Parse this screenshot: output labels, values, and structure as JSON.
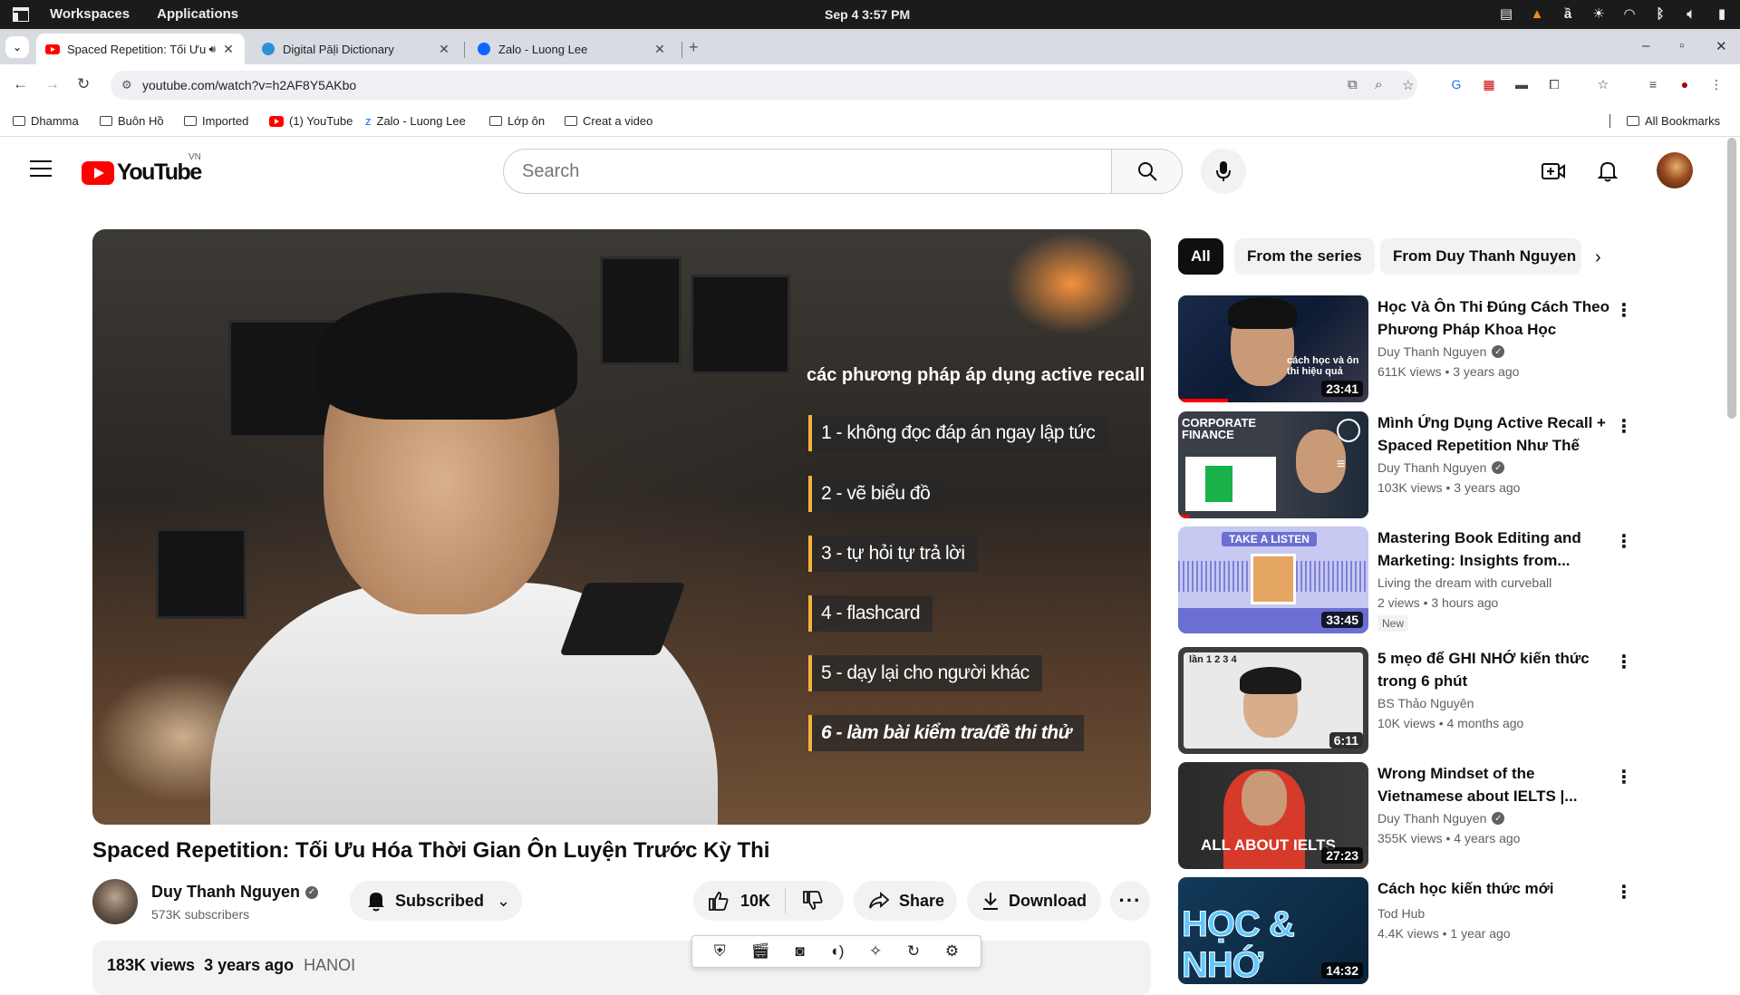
{
  "os": {
    "menu": [
      "Workspaces",
      "Applications"
    ],
    "clock": "Sep 4   3:57 PM"
  },
  "tabs": [
    {
      "title": "Spaced Repetition: Tối Ưu",
      "active": true
    },
    {
      "title": "Digital Pāḷi Dictionary",
      "active": false
    },
    {
      "title": "Zalo - Luong Lee",
      "active": false
    }
  ],
  "address": {
    "url": "youtube.com/watch?v=h2AF8Y5AKbo"
  },
  "bookmarks": [
    {
      "label": "Dhamma",
      "type": "folder"
    },
    {
      "label": "Buôn Hồ",
      "type": "folder"
    },
    {
      "label": "Imported",
      "type": "folder"
    },
    {
      "label": "(1) YouTube",
      "type": "youtube"
    },
    {
      "label": "Zalo - Luong Lee",
      "type": "zalo"
    },
    {
      "label": "Lớp ôn",
      "type": "folder"
    },
    {
      "label": "Creat a video",
      "type": "folder"
    },
    {
      "label": "All Bookmarks",
      "type": "folder"
    }
  ],
  "yt": {
    "logo_text": "YouTube",
    "country": "VN",
    "search_placeholder": "Search"
  },
  "video": {
    "overlay_title": "các phương pháp áp dụng active recall",
    "steps": [
      "1 - không đọc đáp án ngay lập tức",
      "2 - vẽ biểu đồ",
      "3 - tự hỏi tự trả lời",
      "4 - flashcard",
      "5 - dạy lại cho người khác",
      "6 - làm bài kiểm tra/đề thi thử"
    ],
    "title": "Spaced Repetition: Tối Ưu Hóa Thời Gian Ôn Luyện Trước Kỳ Thi",
    "channel": "Duy Thanh Nguyen",
    "subscribers": "573K subscribers",
    "subscribe_label": "Subscribed",
    "likes": "10K",
    "share_label": "Share",
    "download_label": "Download",
    "views": "183K views",
    "age": "3 years ago",
    "location": "HANOI"
  },
  "chips": [
    "All",
    "From the series",
    "From Duy Thanh Nguyen"
  ],
  "recommendations": [
    {
      "title": "Học Và Ôn Thi Đúng Cách Theo Phương Pháp Khoa Học",
      "channel": "Duy Thanh Nguyen",
      "verified": true,
      "views": "611K views",
      "age": "3 years ago",
      "duration": "23:41",
      "thumb_text": "cách học và ôn thi hiệu quả"
    },
    {
      "title": "Mình Ứng Dụng Active Recall + Spaced Repetition Như Thế Nà...",
      "channel": "Duy Thanh Nguyen",
      "verified": true,
      "views": "103K views",
      "age": "3 years ago",
      "duration": "",
      "thumb_text": "CORPORATE FINANCE"
    },
    {
      "title": "Mastering Book Editing and Marketing: Insights from...",
      "channel": "Living the dream with curveball",
      "verified": false,
      "views": "2 views",
      "age": "3 hours ago",
      "duration": "33:45",
      "badge": "New",
      "thumb_text": "TAKE A LISTEN"
    },
    {
      "title": "5 mẹo để GHI NHỚ kiến thức trong 6 phút",
      "channel": "BS Thảo Nguyên",
      "verified": false,
      "views": "10K views",
      "age": "4 months ago",
      "duration": "6:11",
      "thumb_text": "lần 1  2  3  4"
    },
    {
      "title": "Wrong Mindset of the Vietnamese about IELTS |...",
      "channel": "Duy Thanh Nguyen",
      "verified": true,
      "views": "355K views",
      "age": "4 years ago",
      "duration": "27:23",
      "thumb_text": "ALL ABOUT IELTS"
    },
    {
      "title": "Cách học kiến thức mới",
      "channel": "Tod Hub",
      "verified": false,
      "views": "4.4K views",
      "age": "1 year ago",
      "duration": "14:32",
      "thumb_text": "HỌC & NHỚ"
    }
  ],
  "colors": {
    "brand_red": "#ff0000",
    "accent_step": "#f6b23a"
  }
}
